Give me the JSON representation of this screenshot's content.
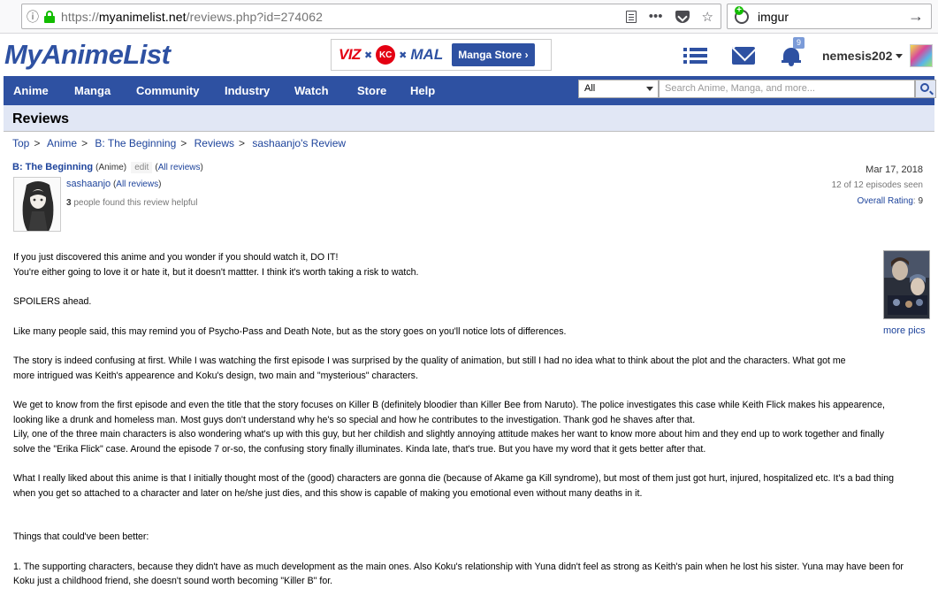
{
  "browser": {
    "url_scheme": "https://",
    "url_host": "myanimelist.net",
    "url_path": "/reviews.php?id=274062",
    "search_value": "imgur"
  },
  "header": {
    "logo": "MyAnimeList",
    "banner": {
      "viz": "VIZ",
      "kc": "KC",
      "mal": "MAL",
      "store_label": "Manga Store ›"
    },
    "notification_count": "9",
    "username": "nemesis202"
  },
  "nav": {
    "items": [
      "Anime",
      "Manga",
      "Community",
      "Industry",
      "Watch",
      "Store",
      "Help"
    ],
    "search_scope": "All",
    "search_placeholder": "Search Anime, Manga, and more..."
  },
  "page_title": "Reviews",
  "breadcrumb": [
    "Top",
    "Anime",
    "B: The Beginning",
    "Reviews",
    "sashaanjo's Review"
  ],
  "review": {
    "title": "B: The Beginning",
    "type": "(Anime)",
    "edit": "edit",
    "all_reviews": "All reviews",
    "reviewer": "sashaanjo",
    "reviewer_all_reviews": "All reviews",
    "helpful_count": "3",
    "helpful_text": "people found this review helpful",
    "date": "Mar 17, 2018",
    "episodes_seen": "12 of 12 episodes seen",
    "overall_rating_label": "Overall Rating",
    "overall_rating": "9",
    "more_pics": "more pics",
    "paragraphs": [
      [
        "If you just discovered this anime and you wonder if you should watch it, DO IT!",
        "You're either going to love it or hate it, but it doesn't mattter. I think it's worth taking a risk to watch."
      ],
      [
        "SPOILERS ahead."
      ],
      [
        "Like many people said, this may remind you of Psycho-Pass and Death Note, but as the story goes on you'll notice lots of differences."
      ],
      [
        "The story is indeed confusing at first. While I was watching the first episode I was surprised by the quality of animation, but still I had no idea what to think about the plot and the characters. What got me",
        "more intrigued was Keith's appearence and Koku's design, two main and \"mysterious\" characters."
      ],
      [
        "We get to know from the first episode and even the title that the story focuses on Killer B (definitely bloodier than Killer Bee from Naruto). The police investigates this case while Keith Flick makes his appearence,",
        "looking like a drunk and homeless man. Most guys don't understand why he's so special and how he contributes to the investigation. Thank god he shaves after that.",
        "Lily, one of the three main characters is also wondering what's up with this guy, but her childish and slightly annoying attitude makes her want to know more about him and they end up to work together and finally",
        "solve the \"Erika Flick\" case. Around the episode 7 or-so, the confusing story finally illuminates. Kinda late, that's true. But you have my word that it gets better after that."
      ],
      [
        "What I really liked about this anime is that I initially thought most of the (good) characters are gonna die (because of Akame ga Kill syndrome), but most of them just got hurt, injured, hospitalized etc. It's a bad thing",
        "when you get so attached to a character and later on he/she just dies, and this show is capable of making you emotional even without many deaths in it."
      ],
      [
        ""
      ],
      [
        "Things that could've been better:"
      ],
      [
        "1. The supporting characters, because they didn't have as much development as the main ones. Also Koku's relationship with Yuna didn't feel as strong as Keith's pain when he lost his sister. Yuna may have been for",
        "Koku just a childhood friend, she doesn't sound worth becoming \"Killer B\" for."
      ]
    ]
  }
}
